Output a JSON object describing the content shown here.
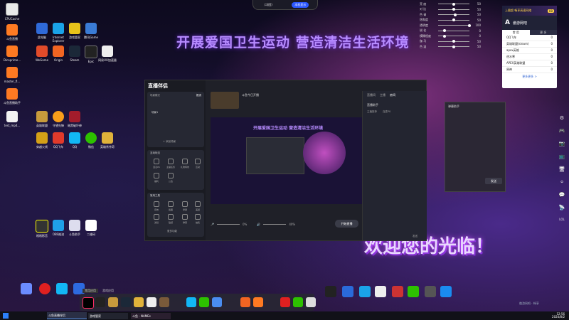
{
  "top_bar": {
    "left_label": "口(回)",
    "right_label": "本机显示"
  },
  "banner": "开展爱国卫生运动  营造清洁生活环境",
  "welcome": "欢迎您的光临！",
  "desktop_icons_left": [
    "CPUCache",
    "斗鱼直播",
    "Dicoprime...",
    "master_fl...",
    "斗鱼直播助手",
    "test_mp4..."
  ],
  "desktop_icons_col2": [
    "此电脑",
    "Internet Explorer",
    "游戏管家",
    "腾讯Game",
    "WeGame",
    "Origin",
    "Steam",
    "Epic",
    "网易UU加速器",
    "英雄联盟",
    "守望先锋",
    "暗黑破坏神",
    "穿越火线",
    "QQ飞车",
    "QQ",
    "微信",
    "英雄杀传奇"
  ],
  "desktop_icons_bottom": [
    "格格影音",
    "OBS推流",
    "斗鱼助手",
    "二维码"
  ],
  "sliders": [
    {
      "label": "亮 度",
      "value": "50",
      "level": 0.5
    },
    {
      "label": "对 比",
      "value": "50",
      "level": 0.5
    },
    {
      "label": "色 调",
      "value": "50",
      "level": 0.55
    },
    {
      "label": "饱和度",
      "value": "50",
      "level": 0.5
    },
    {
      "label": "透明度",
      "value": "100",
      "level": 1.0
    },
    {
      "label": "锐 化",
      "value": "0",
      "level": 0.2
    },
    {
      "label": "模糊程度",
      "value": "0",
      "level": 0.2
    },
    {
      "label": "伽 马",
      "value": "50",
      "level": 0.5
    },
    {
      "label": "色 温",
      "value": "50",
      "level": 0.5
    }
  ],
  "game_panel": {
    "header": "上霸超 畅享高速网络",
    "badge": "88",
    "brand": "傲游网吧",
    "tabs": [
      "常 用",
      "更 多"
    ],
    "rows": [
      {
        "name": "QQ飞车",
        "val": "0"
      },
      {
        "name": "英雄联盟(steam)",
        "val": "0"
      },
      {
        "name": "apex英雄",
        "val": "0"
      },
      {
        "name": "逆水寒",
        "val": "0"
      },
      {
        "name": "APEX英雄联盟",
        "val": "0"
      },
      {
        "name": "原神",
        "val": "0"
      }
    ],
    "more": "更多更多 >"
  },
  "live_app": {
    "logo": "直播伴侣",
    "scene_label": "场景模式",
    "tabs": [
      "推流",
      "直播"
    ],
    "add_scene": "+ 添加场景",
    "scene_item": "场景1",
    "title": "斗鱼今日开播",
    "interact_title": "互动玩法",
    "interact_items": [
      "连麦PK",
      "主播任务",
      "礼物特效",
      "互动",
      "福利",
      "公告"
    ],
    "tools_title": "常用工具",
    "tools_items": [
      "音效",
      "截图",
      "录屏",
      "美颜",
      "滤镜",
      "贴纸",
      "弹幕",
      "抽奖"
    ],
    "more_tools": "更多功能",
    "volume1": "0%",
    "volume2": "40%",
    "go_live": "开始直播",
    "right_tabs": [
      "直播间",
      "主播",
      "房间"
    ],
    "right_title": "直播助手",
    "right_sub": [
      "主播推荐",
      "连麦PK"
    ],
    "send": "发送"
  },
  "chat_window": {
    "title": "弹幕助手",
    "button": "发送"
  },
  "right_tools": [
    "⚙",
    "🎮",
    "📷",
    "📺",
    "🖥",
    "⚪",
    "💬",
    "📡",
    "LOL"
  ],
  "dock_labels": [
    "常用应用",
    "游戏应用"
  ],
  "taskbar": {
    "items": [
      "斗鱼直播伴侣",
      "游戏管家",
      "斗鱼 - NAMEs"
    ],
    "time": "12:56",
    "date": "2024/8/2"
  },
  "brand_footer": "傲游网吧 · 畅享"
}
